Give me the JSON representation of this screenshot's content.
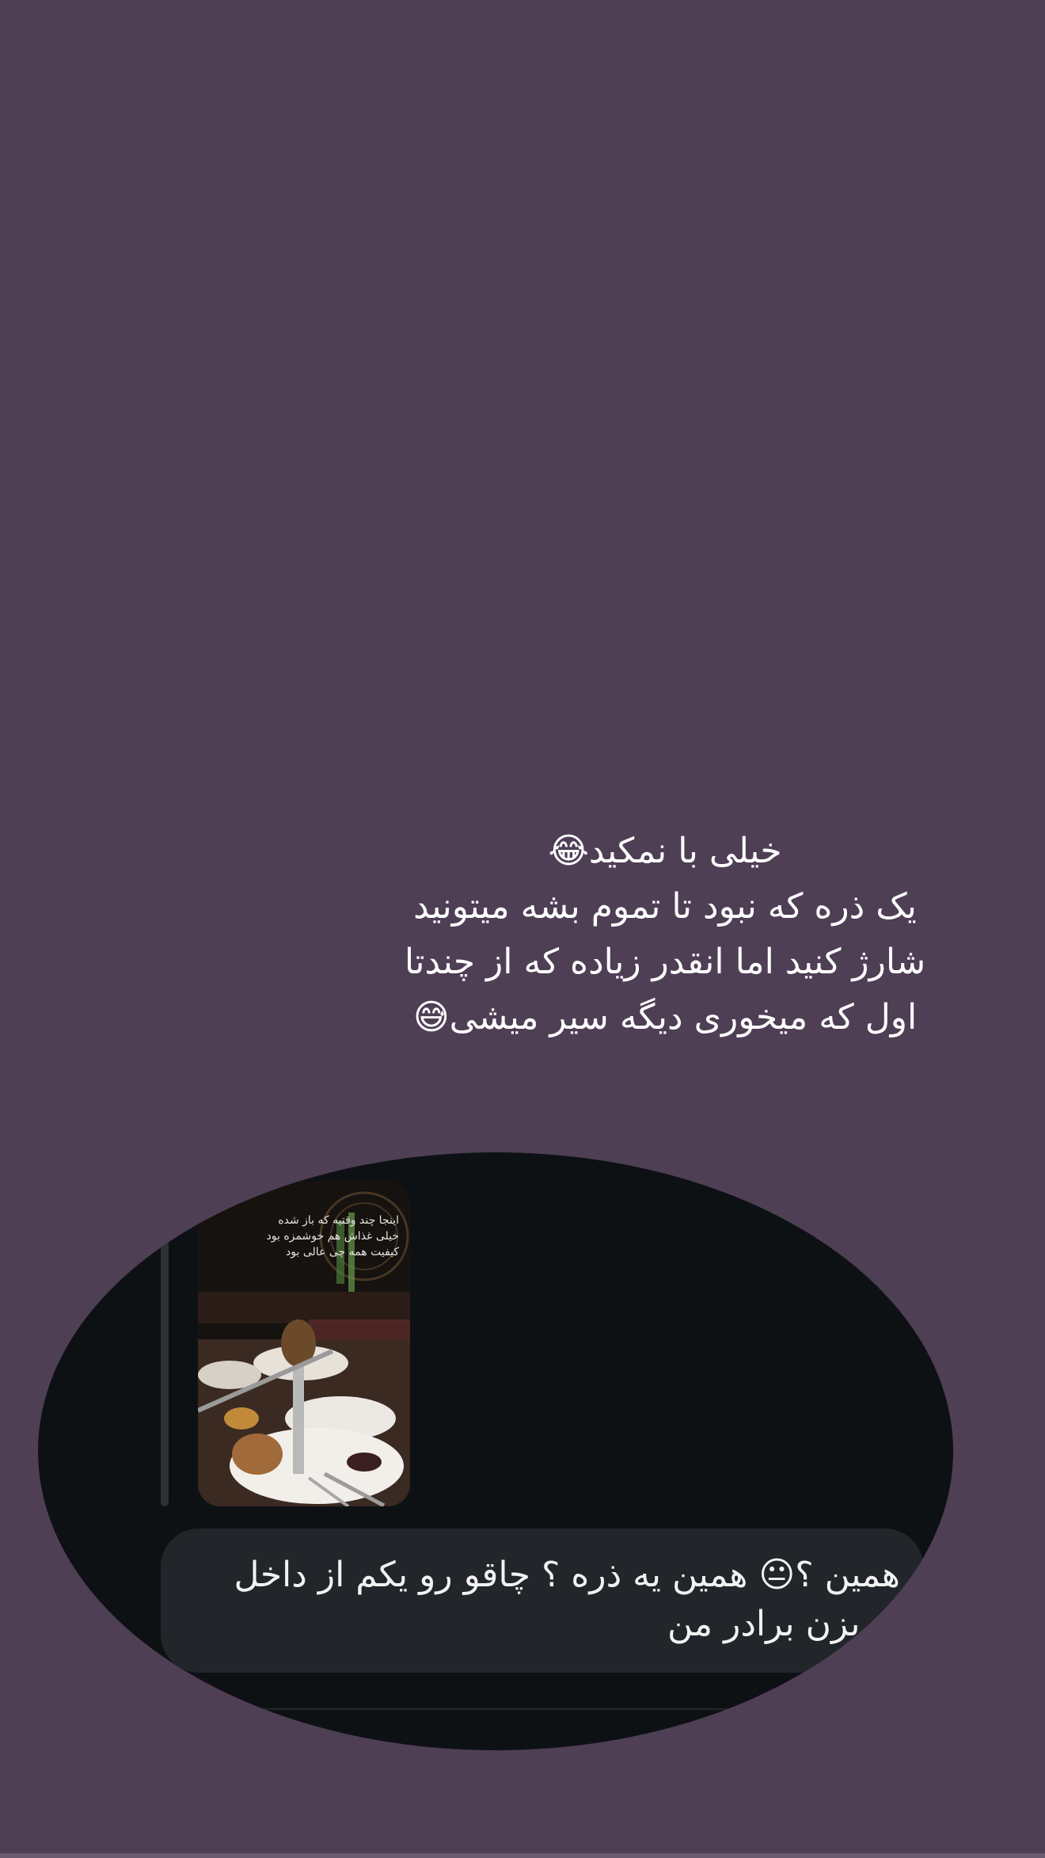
{
  "story": {
    "caption": "خیلی با نمکید😂\nیک ذره که نبود تا تموم بشه میتونید\nشارژ کنید اما انقدر زیاده که از چندتا\nاول که میخوری دیگه سیر میشی😅"
  },
  "chat": {
    "shared_story_text": "اینجا چند وقتیه که باز شده\nخیلی غذاش هم خوشمزه بود\nکیفیت همه چی عالی بود",
    "message": "همین ؟😐 همین یه ذره ؟ چاقو رو یکم از داخل\nتر بزن برادر من"
  },
  "colors": {
    "background": "#4e3f55",
    "chat_background": "#0e1114",
    "bubble": "#222529",
    "text": "#ffffff"
  }
}
